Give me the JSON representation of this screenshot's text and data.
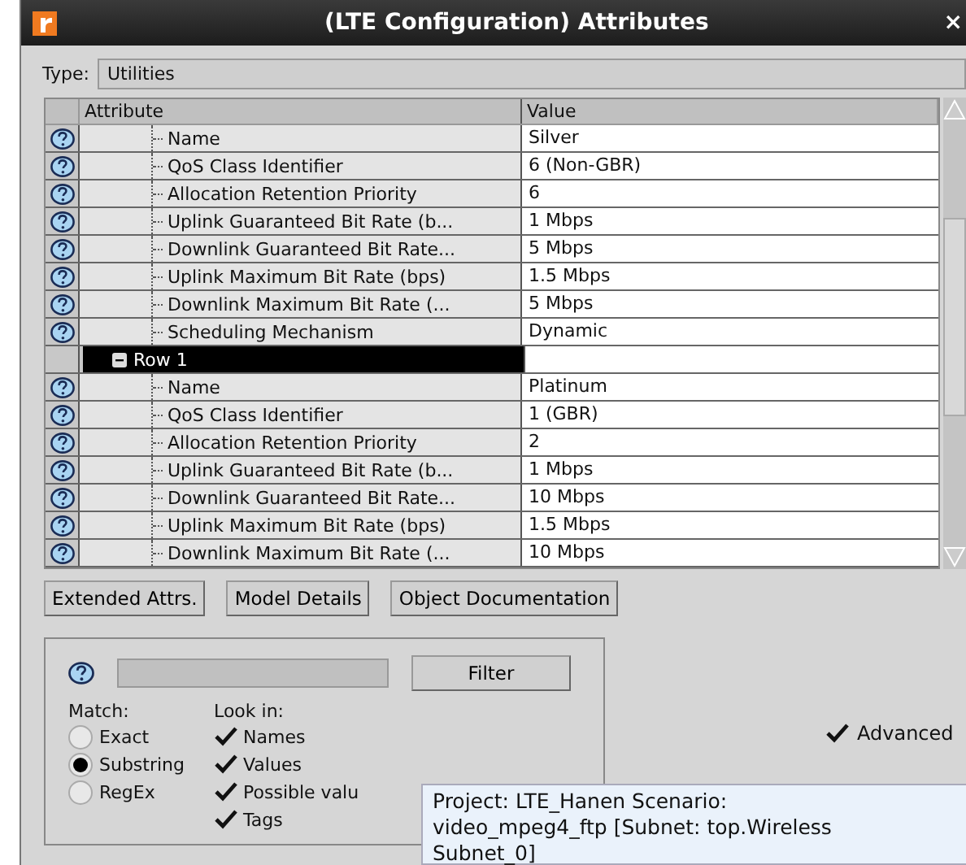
{
  "window": {
    "title": "(LTE Configuration) Attributes",
    "close": "×"
  },
  "type": {
    "label": "Type:",
    "value": "Utilities"
  },
  "table": {
    "columns": [
      "Attribute",
      "Value"
    ],
    "rows": [
      {
        "kind": "leaf",
        "name": "Name",
        "value": "Silver"
      },
      {
        "kind": "leaf",
        "name": "QoS Class Identifier",
        "value": "6 (Non-GBR)"
      },
      {
        "kind": "leaf",
        "name": "Allocation Retention Priority",
        "value": "6"
      },
      {
        "kind": "leaf",
        "name": "Uplink Guaranteed Bit Rate (b...",
        "value": "1 Mbps"
      },
      {
        "kind": "leaf",
        "name": "Downlink Guaranteed Bit Rate...",
        "value": "5 Mbps"
      },
      {
        "kind": "leaf",
        "name": "Uplink Maximum Bit Rate (bps)",
        "value": "1.5 Mbps"
      },
      {
        "kind": "leaf",
        "name": "Downlink Maximum Bit Rate (...",
        "value": "5 Mbps"
      },
      {
        "kind": "leaf",
        "name": "Scheduling Mechanism",
        "value": "Dynamic"
      },
      {
        "kind": "group",
        "name": "Row 1",
        "expanded": true,
        "selected": true,
        "children": [
          {
            "kind": "leaf",
            "name": "Name",
            "value": "Platinum"
          },
          {
            "kind": "leaf",
            "name": "QoS Class Identifier",
            "value": "1 (GBR)"
          },
          {
            "kind": "leaf",
            "name": "Allocation Retention Priority",
            "value": "2"
          },
          {
            "kind": "leaf",
            "name": "Uplink Guaranteed Bit Rate (b...",
            "value": "1 Mbps"
          },
          {
            "kind": "leaf",
            "name": "Downlink Guaranteed Bit Rate...",
            "value": "10 Mbps"
          },
          {
            "kind": "leaf",
            "name": "Uplink Maximum Bit Rate (bps)",
            "value": "1.5 Mbps"
          },
          {
            "kind": "leaf",
            "name": "Downlink Maximum Bit Rate (...",
            "value": "10 Mbps"
          }
        ]
      }
    ]
  },
  "buttons": [
    "Extended Attrs.",
    "Model Details",
    "Object Documentation"
  ],
  "filter": {
    "button": "Filter",
    "match_label": "Match:",
    "look_label": "Look in:",
    "match": [
      {
        "label": "Exact",
        "selected": false
      },
      {
        "label": "Substring",
        "selected": true
      },
      {
        "label": "RegEx",
        "selected": false
      }
    ],
    "look_in": [
      {
        "label": "Names",
        "checked": true
      },
      {
        "label": "Values",
        "checked": true
      },
      {
        "label": "Possible valu",
        "checked": true
      },
      {
        "label": "Tags",
        "checked": true
      }
    ]
  },
  "advanced": {
    "label": "Advanced",
    "checked": true
  },
  "tooltip": "Project: LTE_Hanen Scenario:\nvideo_mpeg4_ftp  [Subnet: top.Wireless\nSubnet_0]"
}
